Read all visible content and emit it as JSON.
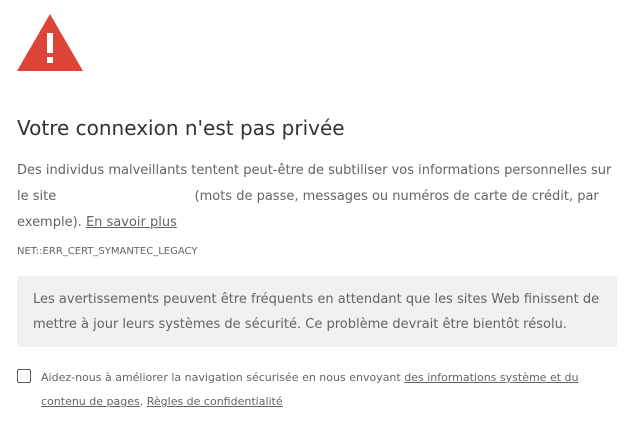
{
  "icon": {
    "name": "warning-triangle-icon",
    "color": "#db4437"
  },
  "heading": {
    "title": "Votre connexion n'est pas privée"
  },
  "description": {
    "text_before_site": "Des individus malveillants tentent peut-être de subtiliser vos informations personnelles sur le site",
    "text_after_site": "(mots de passe, messages ou numéros de carte de crédit, par exemple).",
    "learn_more_link": "En savoir plus"
  },
  "error_code": "NET::ERR_CERT_SYMANTEC_LEGACY",
  "notice": {
    "text": "Les avertissements peuvent être fréquents en attendant que les sites Web finissent de mettre à jour leurs systèmes de sécurité. Ce problème devrait être bientôt résolu."
  },
  "optin": {
    "checked": false,
    "text_before_link": "Aidez-nous à améliorer la navigation sécurisée en nous envoyant",
    "link_system_info": "des informations système et du contenu de pages",
    "separator": ".",
    "link_privacy": "Règles de confidentialité"
  }
}
